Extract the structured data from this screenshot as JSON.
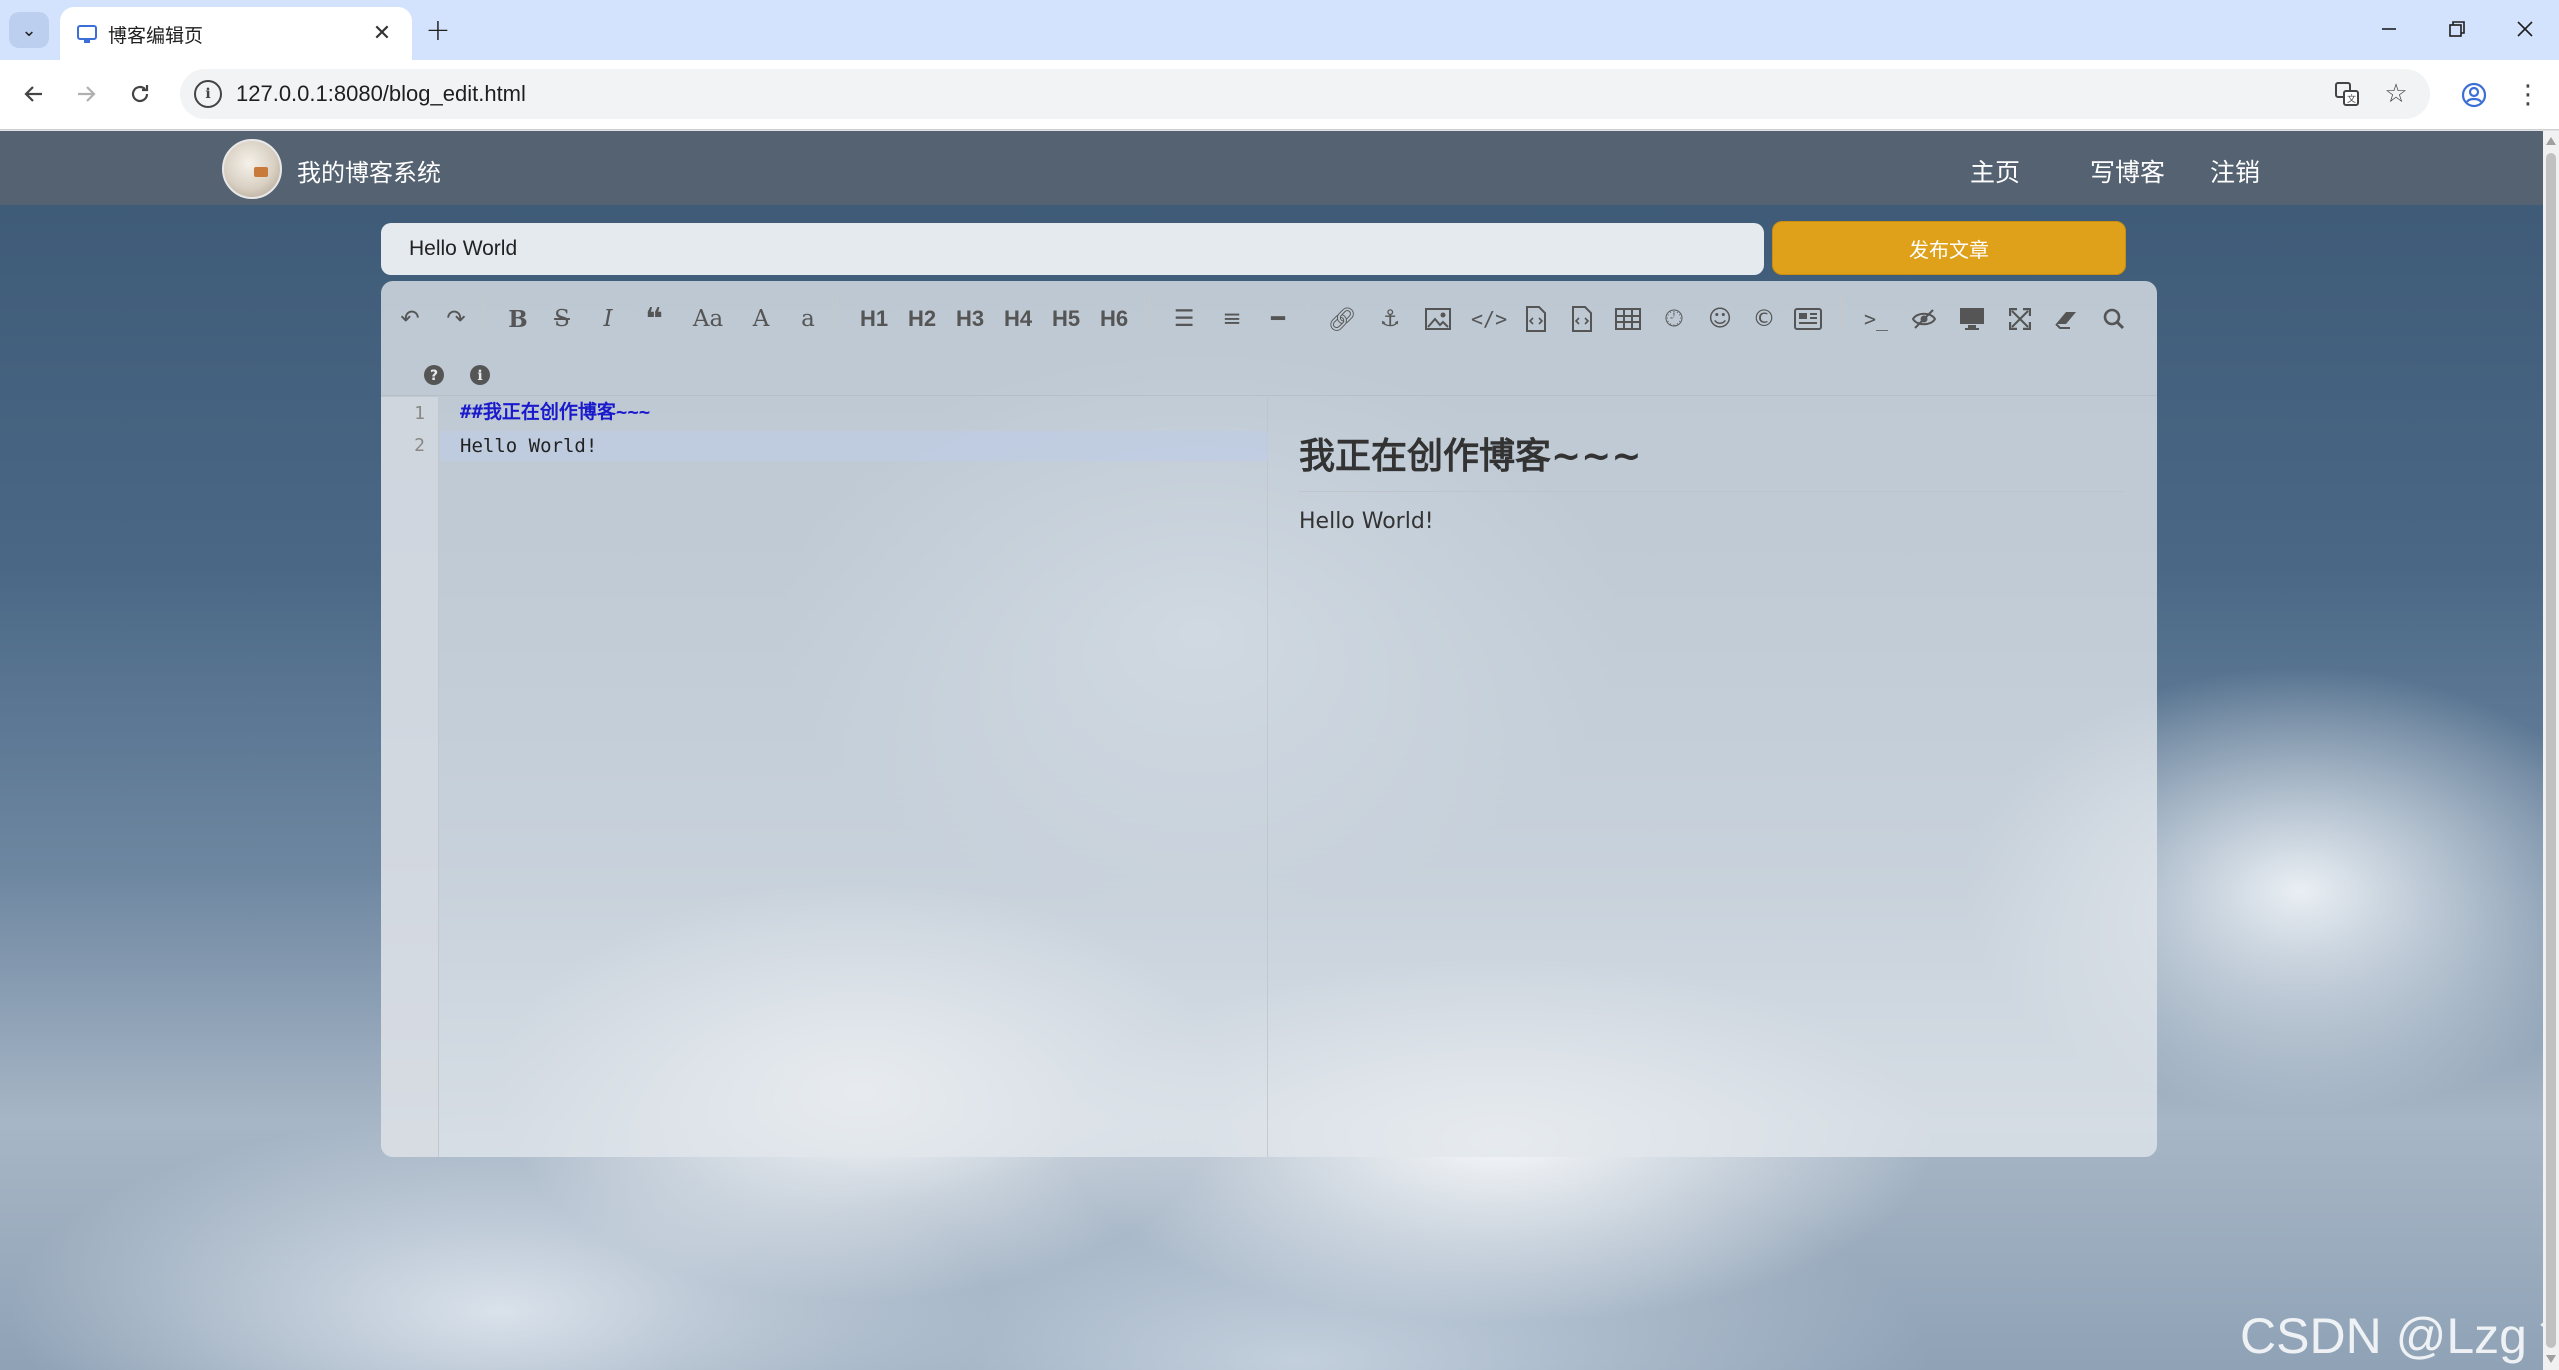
{
  "browser": {
    "tab_title": "博客编辑页",
    "url": "127.0.0.1:8080/blog_edit.html",
    "new_tab_glyph": "+",
    "close_glyph": "✕"
  },
  "site": {
    "brand": "我的博客系统",
    "nav": [
      "主页",
      "写博客",
      "注销"
    ]
  },
  "editor": {
    "title_value": "Hello World",
    "publish_label": "发布文章",
    "toolbar": {
      "headings": [
        "H1",
        "H2",
        "H3",
        "H4",
        "H5",
        "H6"
      ],
      "aa_label": "Aa",
      "uppercase_label": "A",
      "lowercase_label": "a",
      "terminal_label": ">_"
    },
    "lines": [
      {
        "no": "1",
        "text": "##我正在创作博客~~~"
      },
      {
        "no": "2",
        "text": "Hello World!"
      }
    ],
    "preview": {
      "heading": "我正在创作博客~~~",
      "paragraph": "Hello World!"
    }
  },
  "watermark": "CSDN @Lzg丶",
  "colors": {
    "publish": "#e0a11a",
    "code_heading": "#1a1acc",
    "tabstrip": "#d3e3fd"
  }
}
